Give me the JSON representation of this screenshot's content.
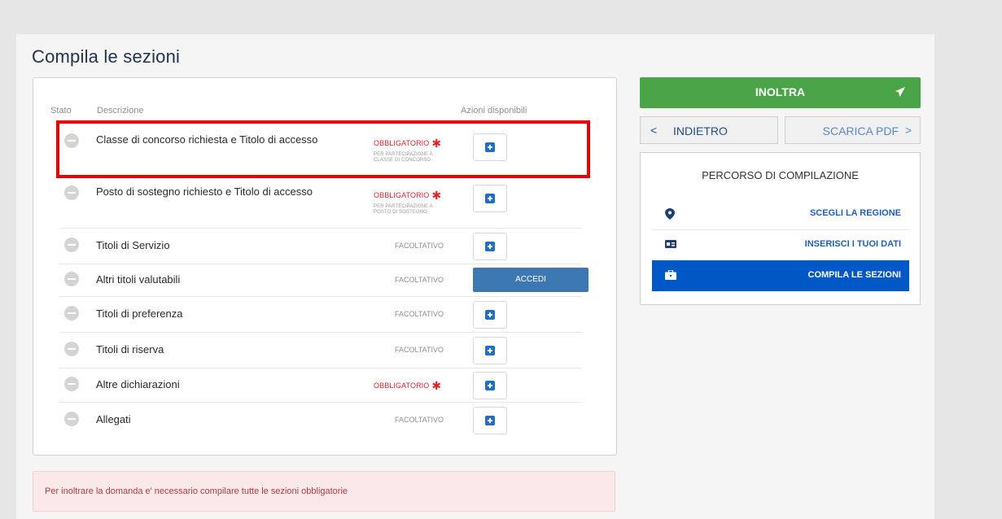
{
  "title": "Compila le sezioni",
  "table": {
    "headers": {
      "stato": "Stato",
      "descrizione": "Descrizione",
      "azioni": "Azioni disponibili"
    },
    "rows": [
      {
        "label": "Classe di concorso richiesta e Titolo di accesso",
        "badge": "OBBLIGATORIO",
        "sub": "PER PARTECIPAZIONE A CLASSE DI CONCORSO",
        "action": "plus"
      },
      {
        "label": "Posto di sostegno richiesto e Titolo di accesso",
        "badge": "OBBLIGATORIO",
        "sub": "PER PARTECIPAZIONE A POSTO DI SOSTEGNO",
        "action": "plus"
      },
      {
        "label": "Titoli di Servizio",
        "badge": "FACOLTATIVO",
        "action": "plus"
      },
      {
        "label": "Altri titoli valutabili",
        "badge": "FACOLTATIVO",
        "action": "accedi",
        "action_label": "ACCEDI"
      },
      {
        "label": "Titoli di preferenza",
        "badge": "FACOLTATIVO",
        "action": "plus"
      },
      {
        "label": "Titoli di riserva",
        "badge": "FACOLTATIVO",
        "action": "plus"
      },
      {
        "label": "Altre dichiarazioni",
        "badge": "OBBLIGATORIO",
        "action": "plus"
      },
      {
        "label": "Allegati",
        "badge": "FACOLTATIVO",
        "action": "plus"
      }
    ]
  },
  "alert": "Per inoltrare la domanda e' necessario compilare tutte le sezioni obbligatorie",
  "buttons": {
    "inoltra": "INOLTRA",
    "indietro": "INDIETRO",
    "scarica_pdf": "SCARICA PDF"
  },
  "percorso": {
    "title": "PERCORSO DI COMPILAZIONE",
    "steps": [
      {
        "label": "SCEGLI LA REGIONE",
        "icon": "map-pin-icon"
      },
      {
        "label": "INSERISCI I TUOI DATI",
        "icon": "id-card-icon"
      },
      {
        "label": "COMPILA LE SEZIONI",
        "icon": "briefcase-icon",
        "active": true
      }
    ]
  },
  "colors": {
    "primary": "#0058c7",
    "success": "#4aa548",
    "danger": "#d9252b"
  }
}
